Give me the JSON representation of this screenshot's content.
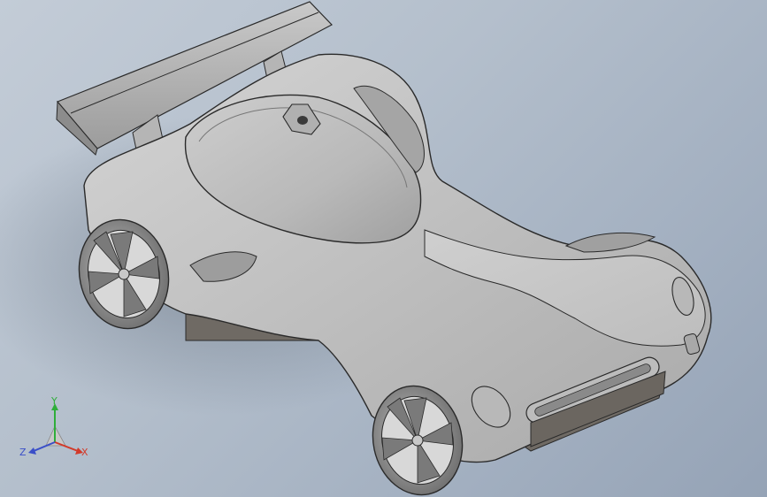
{
  "viewport": {
    "background_top": "#c3ccd7",
    "background_bottom": "#95a3b6",
    "model": "race-car"
  },
  "triad": {
    "x_label": "X",
    "y_label": "Y",
    "z_label": "Z",
    "x_color": "#d23a2a",
    "y_color": "#2fae3a",
    "z_color": "#3a4fc8"
  }
}
